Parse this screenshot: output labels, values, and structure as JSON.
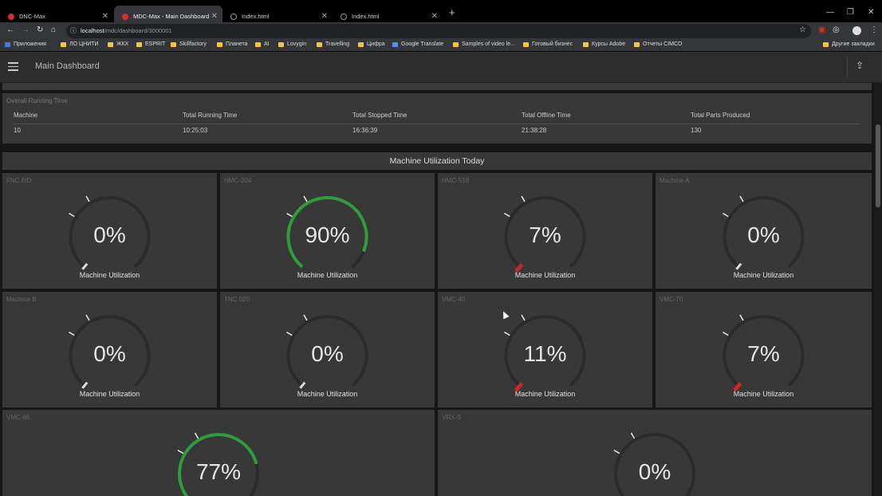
{
  "browser": {
    "tabs": [
      {
        "title": "DNC-Max",
        "icon": "app-icon"
      },
      {
        "title": "MDC-Max - Main Dashboard",
        "icon": "app-icon"
      },
      {
        "title": "Index.html",
        "icon": "globe-icon"
      },
      {
        "title": "Index.html",
        "icon": "globe-icon"
      }
    ],
    "url_host": "localhost",
    "url_path": "/mdc/dashboard/3000001",
    "bookmarks": [
      "Приложения",
      "ЛО ЦНИТИ",
      "ЖКХ",
      "ESPRIT",
      "Skillfactory",
      "Планета",
      "AI",
      "Lovygin",
      "Travelling",
      "Цифра",
      "Google Translate",
      "Samples of video le...",
      "Готовый бизнес",
      "Курсы Adobe",
      "Отчеты CIMCO"
    ],
    "other_bookmarks": "Другие закладки"
  },
  "app": {
    "title": "Main Dashboard"
  },
  "summary": {
    "title": "Overall Running Time",
    "headers": [
      "Machine",
      "Total Running Time",
      "Total Stopped Time",
      "Total Offline Time",
      "Total Parts Produced"
    ],
    "values": [
      "10",
      "10:25:03",
      "16:36:39",
      "21:38:28",
      "130"
    ]
  },
  "utilization_title": "Machine Utilization Today",
  "gauge_label": "Machine Utilization",
  "colors": {
    "green": "#2e9e3a",
    "red": "#c62828",
    "track": "#2b2b2b",
    "card": "#383838"
  },
  "machines": [
    {
      "name": "FNC 6ID",
      "value": "0%",
      "fraction": 0.0
    },
    {
      "name": "HMC-204",
      "value": "90%",
      "fraction": 0.9
    },
    {
      "name": "HMC-518",
      "value": "7%",
      "fraction": 0.07
    },
    {
      "name": "Machine A",
      "value": "0%",
      "fraction": 0.0
    },
    {
      "name": "Machine B",
      "value": "0%",
      "fraction": 0.0
    },
    {
      "name": "TNC 025",
      "value": "0%",
      "fraction": 0.0
    },
    {
      "name": "VMC-40",
      "value": "11%",
      "fraction": 0.11
    },
    {
      "name": "VMC-70",
      "value": "7%",
      "fraction": 0.07
    },
    {
      "name": "VMC-86",
      "value": "77%",
      "fraction": 0.77
    },
    {
      "name": "VRX-S",
      "value": "0%",
      "fraction": 0.0
    }
  ]
}
